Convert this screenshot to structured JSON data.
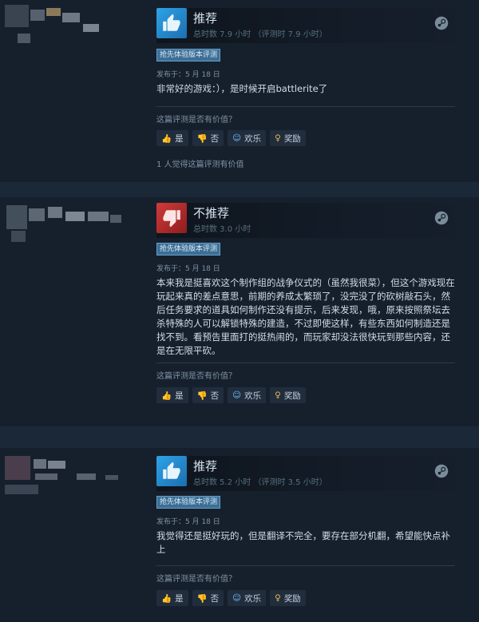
{
  "reviews": [
    {
      "recommendation": "推荐",
      "hours": "总时数 7.9 小时 （评测时 7.9 小时）",
      "badge": "抢先体验版本评测",
      "posted": "发布于：5 月 18 日",
      "text": "非常好的游戏：），是时候开启battlerite了",
      "helpful_question": "这篇评测是否有价值？",
      "buttons": {
        "yes": "是",
        "no": "否",
        "funny": "欢乐",
        "award": "奖励"
      },
      "helpful_count": "1 人觉得这篇评测有价值",
      "voted_up": true
    },
    {
      "recommendation": "不推荐",
      "hours": "总时数 3.0 小时",
      "badge": "抢先体验版本评测",
      "posted": "发布于：5 月 18 日",
      "text": "本来我是挺喜欢这个制作组的战争仪式的（虽然我很菜），但这个游戏现在玩起来真的差点意思，前期的养成太繁琐了，没完没了的砍树敲石头，然后任务要求的道具如何制作还没有提示，后来发现，哦，原来按照祭坛去杀特殊的人可以解锁特殊的建造，不过即使这样，有些东西如何制造还是找不到。看预告里面打的挺热闹的，而玩家却没法很快玩到那些内容，还是在无限平砍。",
      "helpful_question": "这篇评测是否有价值？",
      "buttons": {
        "yes": "是",
        "no": "否",
        "funny": "欢乐",
        "award": "奖励"
      },
      "voted_up": false
    },
    {
      "recommendation": "推荐",
      "hours": "总时数 5.2 小时 （评测时 3.5 小时）",
      "badge": "抢先体验版本评测",
      "posted": "发布于：5 月 18 日",
      "text": "我觉得还是挺好玩的，但是翻译不完全，要存在部分机翻，希望能快点补上",
      "helpful_question": "这篇评测是否有价值？",
      "buttons": {
        "yes": "是",
        "no": "否",
        "funny": "欢乐",
        "award": "奖励"
      },
      "voted_up": true
    }
  ],
  "colors": {
    "background": "#1b2838",
    "card": "#16202d",
    "thumb_up": "#2ea3e7",
    "thumb_down": "#d23a3a",
    "badge": "#3d6f96",
    "link": "#66c0f4"
  },
  "icons": [
    "thumbs-up-icon",
    "thumbs-down-icon",
    "steam-icon",
    "smiley-icon",
    "award-icon"
  ]
}
